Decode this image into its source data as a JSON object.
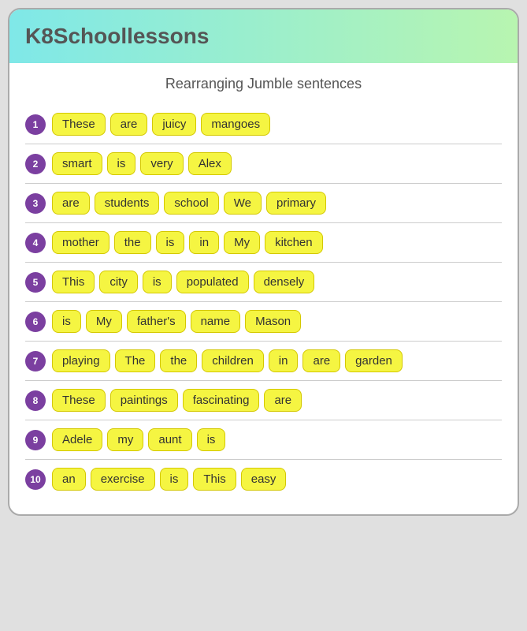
{
  "header": {
    "title": "K8Schoollessons"
  },
  "page": {
    "title": "Rearranging Jumble sentences"
  },
  "sentences": [
    {
      "number": "1",
      "words": [
        "These",
        "are",
        "juicy",
        "mangoes"
      ]
    },
    {
      "number": "2",
      "words": [
        "smart",
        "is",
        "very",
        "Alex"
      ]
    },
    {
      "number": "3",
      "words": [
        "are",
        "students",
        "school",
        "We",
        "primary"
      ]
    },
    {
      "number": "4",
      "words": [
        "mother",
        "the",
        "is",
        "in",
        "My",
        "kitchen"
      ]
    },
    {
      "number": "5",
      "words": [
        "This",
        "city",
        "is",
        "populated",
        "densely"
      ]
    },
    {
      "number": "6",
      "words": [
        "is",
        "My",
        "father's",
        "name",
        "Mason"
      ]
    },
    {
      "number": "7",
      "words": [
        "playing",
        "The",
        "the",
        "children",
        "in",
        "are",
        "garden"
      ]
    },
    {
      "number": "8",
      "words": [
        "These",
        "paintings",
        "fascinating",
        "are"
      ]
    },
    {
      "number": "9",
      "words": [
        "Adele",
        "my",
        "aunt",
        "is"
      ]
    },
    {
      "number": "10",
      "words": [
        "an",
        "exercise",
        "is",
        "This",
        "easy"
      ]
    }
  ]
}
